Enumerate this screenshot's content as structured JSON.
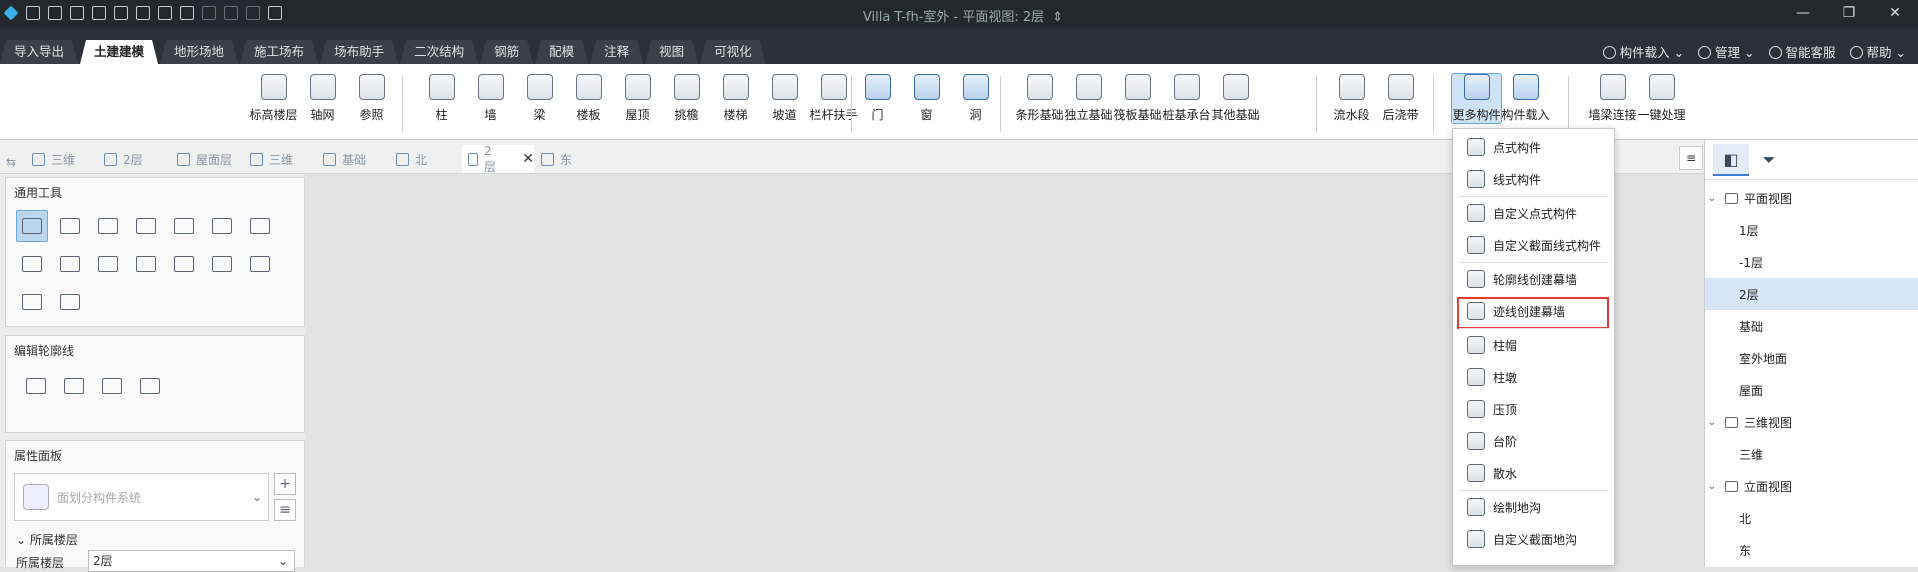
{
  "window": {
    "title": "Villa T-fh-室外 - 平面视图: 2层",
    "title_suffix": "⇕",
    "minimize": "—",
    "restore": "❐",
    "close": "✕"
  },
  "ribbon_tabs": [
    "导入导出",
    "土建建模",
    "地形场地",
    "施工场布",
    "场布助手",
    "二次结构",
    "钢筋",
    "配模",
    "注释",
    "视图",
    "可视化"
  ],
  "active_tab": "土建建模",
  "top_right": {
    "component_load": "构件载入",
    "manage": "管理",
    "smart_service": "智能客服",
    "help": "帮助"
  },
  "ribbon_buttons": {
    "g1": [
      "标高楼层",
      "轴网",
      "参照"
    ],
    "g2": [
      "柱",
      "墙",
      "梁",
      "楼板",
      "屋顶",
      "挑檐",
      "楼梯",
      "坡道",
      "栏杆扶手"
    ],
    "g3": [
      "门",
      "窗",
      "洞"
    ],
    "g4": [
      "条形基础",
      "独立基础",
      "筏板基础",
      "桩基承台",
      "其他基础"
    ],
    "g5": [
      "流水段",
      "后浇带"
    ],
    "g6": [
      "更多构件",
      "构件载入"
    ],
    "g7": [
      "墙梁连接",
      "一键处理"
    ]
  },
  "doc_tabs": [
    "三维",
    "2层",
    "屋面层",
    "三维",
    "基础",
    "北",
    "2层",
    "东"
  ],
  "doc_tab_close": "✕",
  "doc_menu_btn": "≡",
  "left_panel": {
    "general_tools": "通用工具",
    "edit_contour": "编辑轮廓线",
    "properties": "属性面板",
    "combo_placeholder": "面划分构件系统",
    "add_btn": "+",
    "list_btn": "≡",
    "floor_section": "所属楼层",
    "floor_label": "所属楼层",
    "floor_value": "2层"
  },
  "dropdown": [
    "点式构件",
    "线式构件",
    "自定义点式构件",
    "自定义截面线式构件",
    "轮廓线创建幕墙",
    "迹线创建幕墙",
    "柱帽",
    "柱墩",
    "压顶",
    "台阶",
    "散水",
    "绘制地沟",
    "自定义截面地沟"
  ],
  "dropdown_highlighted": "迹线创建幕墙",
  "tree": {
    "plan_view": "平面视图",
    "plan_items": [
      "1层",
      "-1层",
      "2层",
      "基础",
      "室外地面",
      "屋面"
    ],
    "selected": "2层",
    "view3d": "三维视图",
    "view3d_items": [
      "三维"
    ],
    "elev_view": "立面视图",
    "elev_items": [
      "北",
      "东"
    ]
  },
  "colors": {
    "accent": "#3a7bd5",
    "highlight_box": "#e53935",
    "titlebar": "#23272e"
  }
}
